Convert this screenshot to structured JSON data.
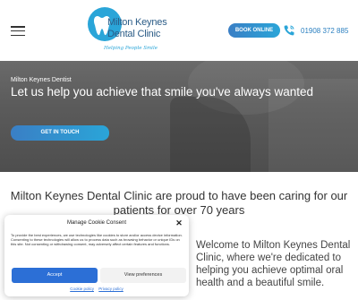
{
  "header": {
    "logo": {
      "line1": "Milton Keynes",
      "line2": "Dental Clinic",
      "tagline": "Helping People Smile"
    },
    "book_online": "BOOK ONLINE",
    "phone": "01908 372 885"
  },
  "hero": {
    "subtitle": "Milton Keynes Dentist",
    "title": "Let us help you achieve that smile you've always wanted",
    "cta": "GET IN TOUCH"
  },
  "intro": "Milton Keynes Dental Clinic are proud to have been caring for our patients for over 70 years",
  "welcome": "Welcome to Milton Keynes Dental Clinic, where we're dedicated to helping you achieve optimal oral health and a beautiful smile.",
  "cookie": {
    "title": "Manage Cookie Consent",
    "close": "✕",
    "text": "To provide the best experiences, we use technologies like cookies to store and/or access device information. Consenting to these technologies will allow us to process data such as browsing behavior or unique IDs on this site. Not consenting or withdrawing consent, may adversely affect certain features and functions.",
    "accept": "Accept",
    "preferences": "View preferences",
    "cookie_policy": "Cookie policy",
    "privacy_policy": "Privacy policy"
  },
  "colors": {
    "brand_blue": "#2aa5d8",
    "brand_navy": "#2a5b86",
    "accept_blue": "#2c6fd6"
  }
}
